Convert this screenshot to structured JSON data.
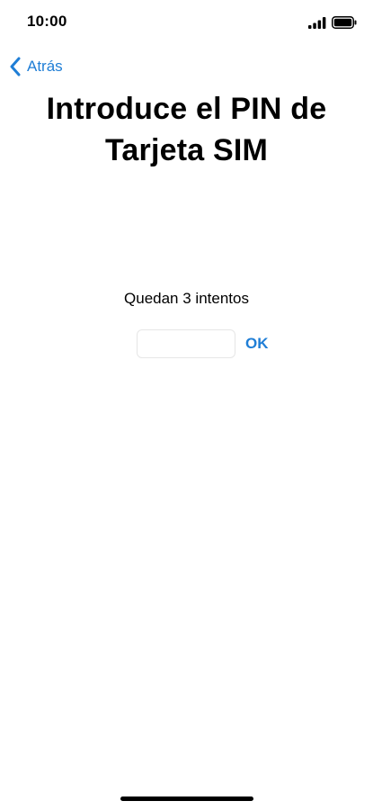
{
  "status_bar": {
    "time": "10:00",
    "icons": [
      "signal-icon",
      "battery-icon"
    ]
  },
  "nav": {
    "back_label": "Atrás",
    "back_icon": "chevron-left-icon"
  },
  "title": "Introduce el PIN de Tarjeta SIM",
  "pin": {
    "attempts_text": "Quedan 3 intentos",
    "value": "",
    "placeholder": "",
    "ok_label": "OK"
  },
  "colors": {
    "accent": "#1f7ed6",
    "text": "#000000",
    "background": "#ffffff"
  }
}
